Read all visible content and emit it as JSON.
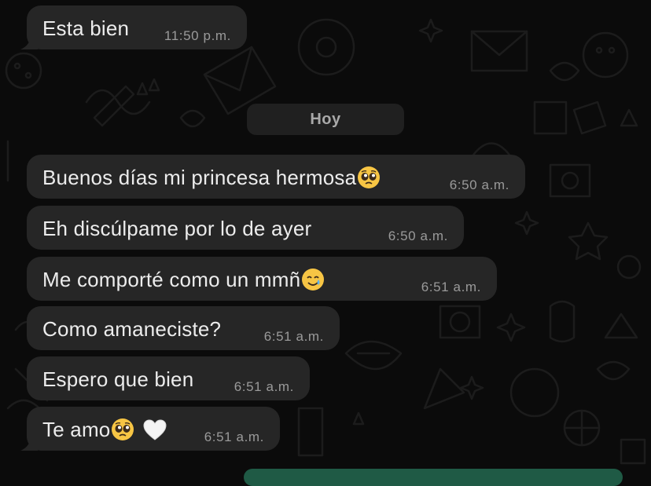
{
  "date_separator": "Hoy",
  "messages": [
    {
      "text": "Esta bien",
      "time": "11:50 p.m.",
      "emoji": []
    },
    {
      "text": "Buenos días mi princesa hermosa",
      "time": "6:50 a.m.",
      "emoji": [
        "pleading-face"
      ]
    },
    {
      "text": "Eh discúlpame por lo de ayer",
      "time": "6:50 a.m.",
      "emoji": []
    },
    {
      "text": "Me comporté como un mmñ",
      "time": "6:51 a.m.",
      "emoji": [
        "smiling-face-with-tear"
      ]
    },
    {
      "text": "Como amaneciste?",
      "time": "6:51 a.m.",
      "emoji": []
    },
    {
      "text": "Espero que bien",
      "time": "6:51 a.m.",
      "emoji": []
    },
    {
      "text": "Te amo",
      "time": "6:51 a.m.",
      "emoji": [
        "pleading-face",
        "white-heart"
      ]
    }
  ],
  "colors": {
    "background": "#0b0b0b",
    "bubble": "#262626",
    "bubble_text": "#ececec",
    "timestamp": "#9a9a9a",
    "date_pill": "#202020",
    "accent_green": "#1f5a45"
  }
}
